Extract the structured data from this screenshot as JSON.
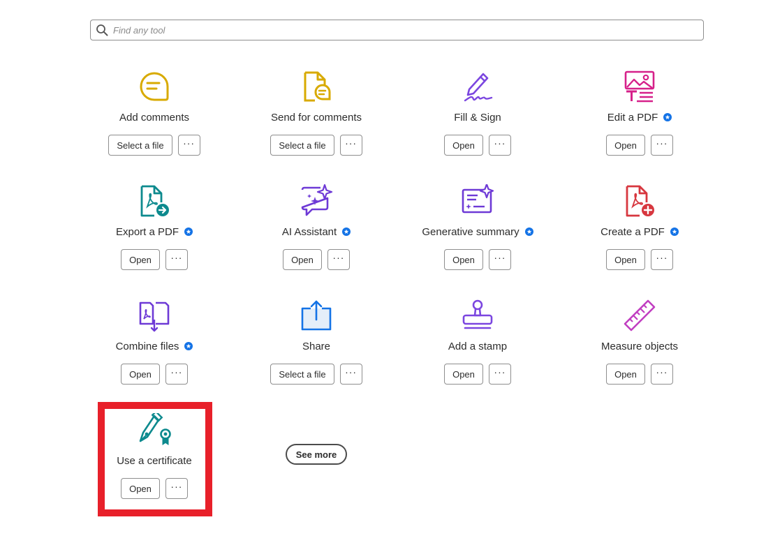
{
  "search": {
    "placeholder": "Find any tool",
    "value": ""
  },
  "tools": [
    {
      "name": "Add comments",
      "icon": "add-comments-icon",
      "premium": false,
      "primary_label": "Select a file",
      "more_label": "···"
    },
    {
      "name": "Send for comments",
      "icon": "send-for-comments-icon",
      "premium": false,
      "primary_label": "Select a file",
      "more_label": "···"
    },
    {
      "name": "Fill & Sign",
      "icon": "fill-sign-icon",
      "premium": false,
      "primary_label": "Open",
      "more_label": "···"
    },
    {
      "name": "Edit a PDF",
      "icon": "edit-pdf-icon",
      "premium": true,
      "primary_label": "Open",
      "more_label": "···"
    },
    {
      "name": "Export a PDF",
      "icon": "export-pdf-icon",
      "premium": true,
      "primary_label": "Open",
      "more_label": "···"
    },
    {
      "name": "AI Assistant",
      "icon": "ai-assistant-icon",
      "premium": true,
      "primary_label": "Open",
      "more_label": "···"
    },
    {
      "name": "Generative summary",
      "icon": "generative-summary-icon",
      "premium": true,
      "primary_label": "Open",
      "more_label": "···"
    },
    {
      "name": "Create a PDF",
      "icon": "create-pdf-icon",
      "premium": true,
      "primary_label": "Open",
      "more_label": "···"
    },
    {
      "name": "Combine files",
      "icon": "combine-files-icon",
      "premium": true,
      "primary_label": "Open",
      "more_label": "···"
    },
    {
      "name": "Share",
      "icon": "share-icon",
      "premium": false,
      "primary_label": "Select a file",
      "more_label": "···"
    },
    {
      "name": "Add a stamp",
      "icon": "stamp-icon",
      "premium": false,
      "primary_label": "Open",
      "more_label": "···"
    },
    {
      "name": "Measure objects",
      "icon": "ruler-icon",
      "premium": false,
      "primary_label": "Open",
      "more_label": "···"
    },
    {
      "name": "Use a certificate",
      "icon": "certificate-icon",
      "premium": false,
      "primary_label": "Open",
      "more_label": "···"
    }
  ],
  "see_more_label": "See more",
  "colors": {
    "premium_badge": "#1473e6",
    "highlight_border": "#e8202a"
  }
}
